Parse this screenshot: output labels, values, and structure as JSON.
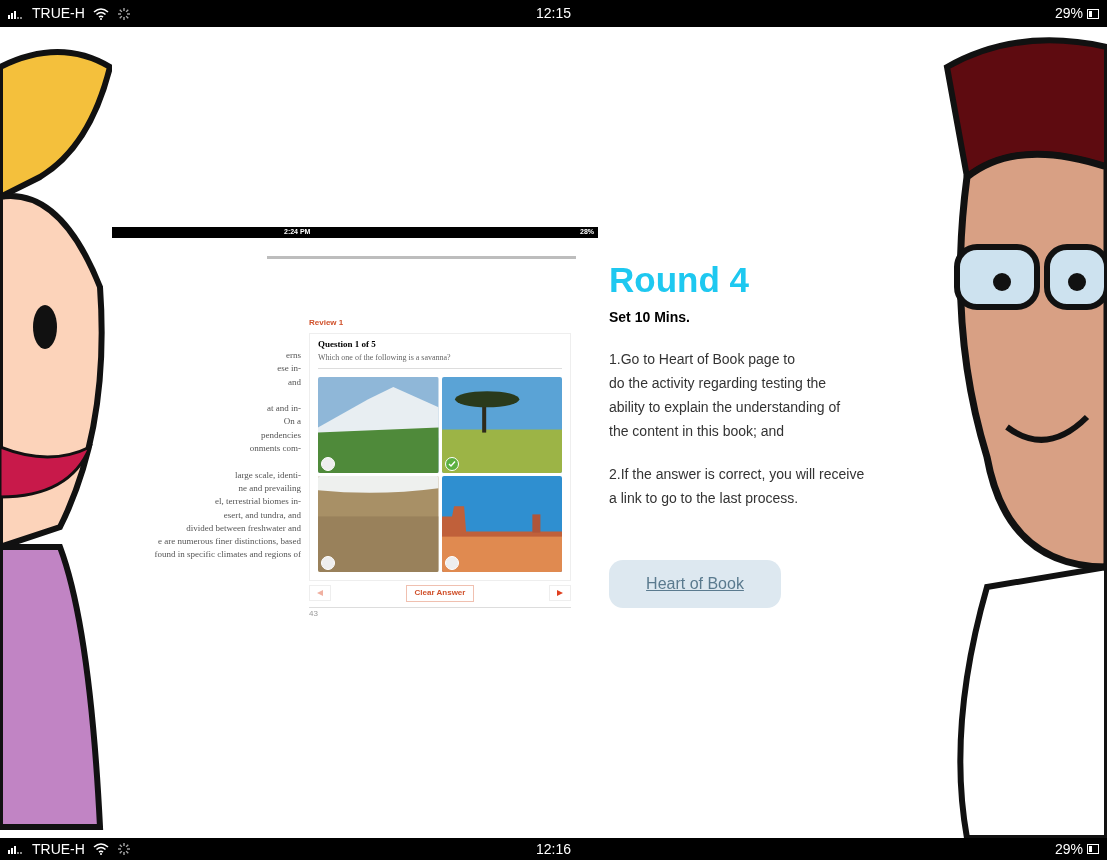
{
  "status_bars": [
    {
      "carrier": "TRUE-H",
      "time": "12:15",
      "battery": "29%"
    },
    {
      "carrier": "TRUE-H",
      "time": "12:16",
      "battery": "29%"
    }
  ],
  "embedded_screenshot": {
    "status_time": "2:24 PM",
    "status_battery": "28%",
    "section": "Review 1",
    "book_text_paragraphs": [
      {
        "lines": [
          "erns",
          "ese in-",
          "and"
        ]
      },
      {
        "lines": [
          "at and in-",
          "On a",
          "pendencies",
          "onments com-"
        ]
      },
      {
        "lines": [
          "large scale, identi-",
          "ne and prevailing",
          "el, terrestrial biomes in-",
          "esert, and tundra, and",
          "divided between freshwater and",
          "e are numerous finer distinctions, based",
          "found in specific climates and regions of"
        ]
      }
    ],
    "question": {
      "title": "Question 1 of 5",
      "prompt": "Which one of the following is a savanna?",
      "options": [
        {
          "kind": "mountain",
          "selected": false
        },
        {
          "kind": "savanna",
          "selected": true
        },
        {
          "kind": "tundra",
          "selected": false
        },
        {
          "kind": "desert",
          "selected": false
        }
      ]
    },
    "clear_button": "Clear Answer",
    "page_number": "43"
  },
  "panel": {
    "title": "Round 4",
    "subtitle": "Set 10 Mins.",
    "paragraphs": [
      {
        "lines": [
          "1.Go to Heart of Book page to",
          "do the activity regarding testing the",
          "ability to explain the understanding of",
          "the content in this book; and"
        ]
      },
      {
        "lines": [
          "2.If the answer is correct, you will receive",
          "a link to go to the last process."
        ]
      }
    ],
    "link_button": "Heart of Book"
  }
}
